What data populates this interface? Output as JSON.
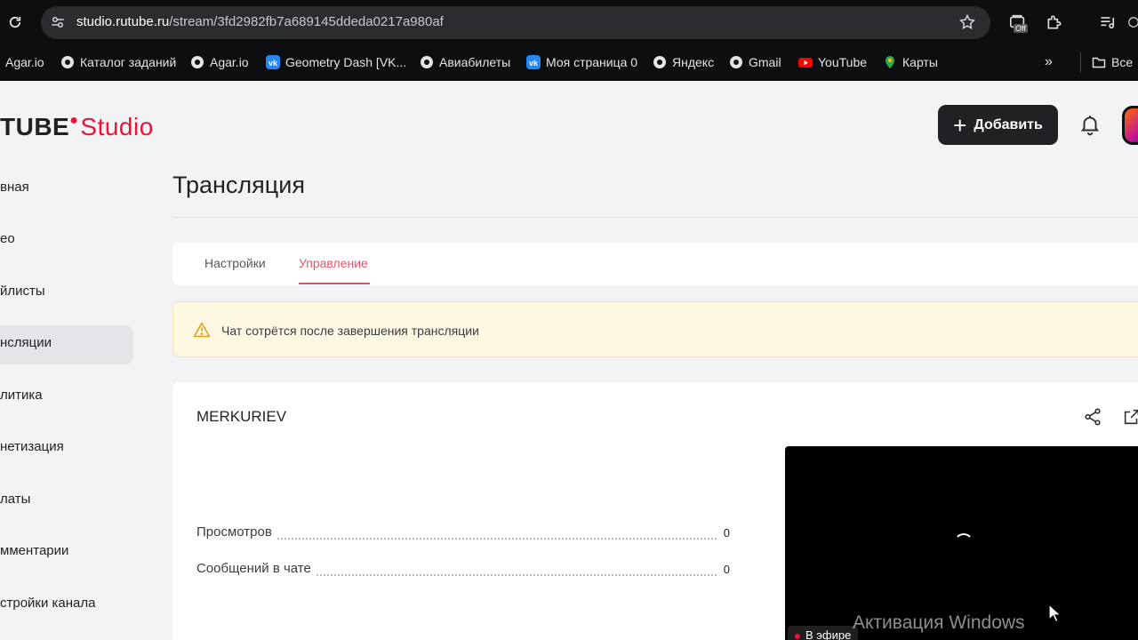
{
  "browser": {
    "url_host": "studio.rutube.ru",
    "url_path": "/stream/3fd2982fb7a689145ddeda0217a980af",
    "ext_badge": "Off",
    "bookmarks": [
      {
        "label": "Agar.io",
        "icon": "none"
      },
      {
        "label": "Каталог заданий",
        "icon": "globe-icon"
      },
      {
        "label": "Agar.io",
        "icon": "globe-icon"
      },
      {
        "label": "Geometry Dash [VK...",
        "icon": "vk-icon"
      },
      {
        "label": "Авиабилеты",
        "icon": "globe-icon"
      },
      {
        "label": "Моя страница 0",
        "icon": "vk-icon"
      },
      {
        "label": "Яндекс",
        "icon": "globe-icon"
      },
      {
        "label": "Gmail",
        "icon": "globe-icon"
      },
      {
        "label": "YouTube",
        "icon": "youtube-icon"
      },
      {
        "label": "Карты",
        "icon": "maps-icon"
      }
    ],
    "more": "»",
    "all_bookmarks": "Все"
  },
  "header": {
    "logo_main": "TUBE",
    "logo_studio": "Studio",
    "add_button": "Добавить"
  },
  "nav": {
    "items": [
      {
        "label": "вная"
      },
      {
        "label": "ео"
      },
      {
        "label": "йлисты"
      },
      {
        "label": "нсляции"
      },
      {
        "label": "литика"
      },
      {
        "label": "нетизация"
      },
      {
        "label": "латы"
      },
      {
        "label": "мментарии"
      },
      {
        "label": "стройки канала"
      }
    ],
    "active_index": 3
  },
  "page": {
    "title": "Трансляция",
    "tabs": [
      {
        "label": "Настройки"
      },
      {
        "label": "Управление"
      }
    ],
    "active_tab": 1,
    "alert": "Чат сотрётся после завершения трансляции"
  },
  "stream": {
    "title": "MERKURIEV",
    "stats": [
      {
        "label": "Просмотров",
        "value": "0"
      },
      {
        "label": "Сообщений в чате",
        "value": "0"
      }
    ],
    "live_badge": "В эфире",
    "watermark": "Активация Windows"
  },
  "colors": {
    "accent": "#e3163c",
    "tab_active": "#e0566e",
    "button_dark": "#1f2124",
    "alert_bg": "#fdf8e1"
  }
}
